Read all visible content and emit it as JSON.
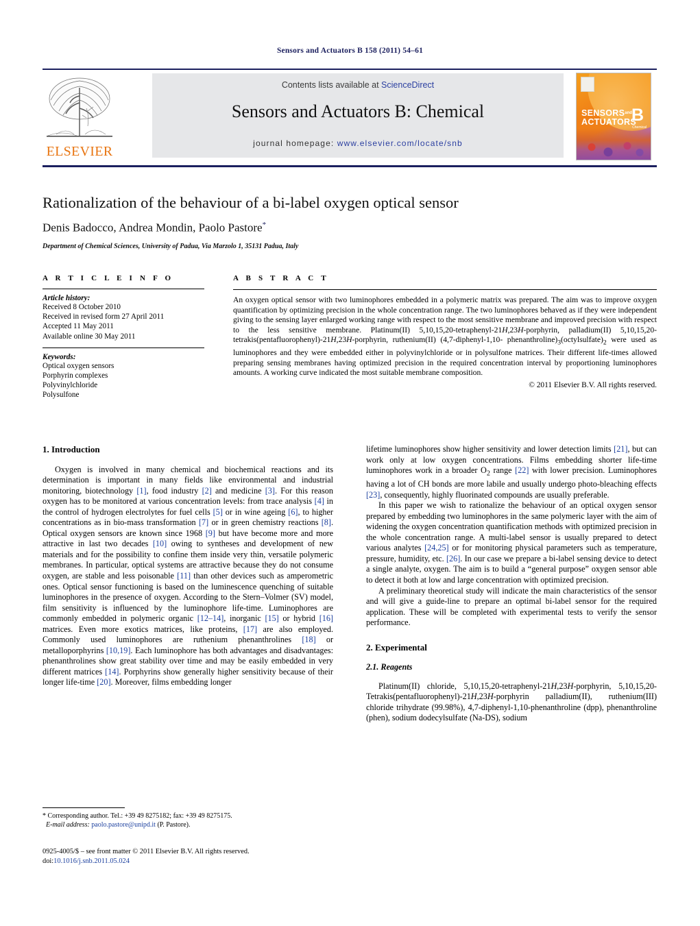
{
  "journal_ref": "Sensors and Actuators B 158 (2011) 54–61",
  "masthead": {
    "publisher_name": "ELSEVIER",
    "contents_prefix": "Contents lists available at ",
    "contents_link": "ScienceDirect",
    "journal_title": "Sensors and Actuators B: Chemical",
    "homepage_label": "journal homepage:",
    "homepage_url": "www.elsevier.com/locate/snb",
    "cover": {
      "line1": "SENSORS",
      "line1_small": "and",
      "line2": "ACTUATORS",
      "letter": "B",
      "sub": "Chemical"
    }
  },
  "article": {
    "title": "Rationalization of the behaviour of a bi-label oxygen optical sensor",
    "authors": "Denis Badocco, Andrea Mondin, Paolo Pastore",
    "corresponding_marker": "*",
    "affiliation": "Department of Chemical Sciences, University of Padua, Via Marzolo 1, 35131 Padua, Italy"
  },
  "article_info": {
    "heading": "A R T I C L E   I N F O",
    "history_label": "Article history:",
    "history": [
      "Received 8 October 2010",
      "Received in revised form 27 April 2011",
      "Accepted 11 May 2011",
      "Available online 30 May 2011"
    ],
    "keywords_label": "Keywords:",
    "keywords": [
      "Optical oxygen sensors",
      "Porphyrin complexes",
      "Polyvinylchloride",
      "Polysulfone"
    ]
  },
  "abstract": {
    "heading": "A B S T R A C T",
    "copyright": "© 2011 Elsevier B.V. All rights reserved."
  },
  "sections": {
    "introduction_heading": "1. Introduction",
    "experimental_heading": "2. Experimental",
    "reagents_heading": "2.1. Reagents"
  },
  "footnote": {
    "corresponding": "* Corresponding author. Tel.: +39 49 8275182; fax: +39 49 8275175.",
    "email_label": "E-mail address:",
    "email": "paolo.pastore@unipd.it",
    "email_person": "(P. Pastore).",
    "imprint": "0925-4005/$ – see front matter © 2011 Elsevier B.V. All rights reserved.",
    "doi_label": "doi:",
    "doi": "10.1016/j.snb.2011.05.024"
  },
  "colors": {
    "link": "#2b3fa0",
    "reference": "#1b3f9e",
    "navy": "#1b1f5e",
    "elsevier_orange": "#E87511",
    "banner_gray": "#e6e7e9"
  }
}
